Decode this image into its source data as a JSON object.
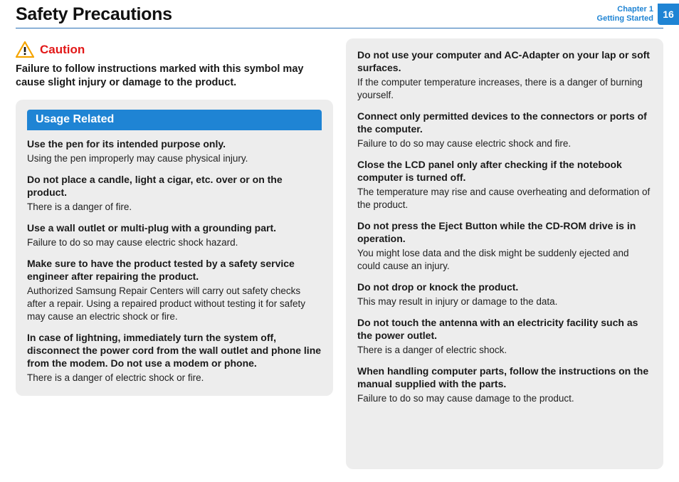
{
  "header": {
    "title": "Safety Precautions",
    "chapter_line1": "Chapter 1",
    "chapter_line2": "Getting Started",
    "page_number": "16"
  },
  "caution": {
    "label": "Caution",
    "description": "Failure to follow instructions marked with this symbol may cause slight injury or damage to the product."
  },
  "section": {
    "title": "Usage Related"
  },
  "left_items": [
    {
      "h": "Use the pen for its intended purpose only.",
      "b": "Using the pen improperly may cause physical injury."
    },
    {
      "h": "Do not place a candle, light a cigar, etc. over or on the product.",
      "b": "There is a danger of fire."
    },
    {
      "h": "Use a wall outlet or multi-plug with a grounding part.",
      "b": "Failure to do so may cause electric shock hazard."
    },
    {
      "h": "Make sure to have the product tested by a safety service engineer after repairing the product.",
      "b": "Authorized Samsung Repair Centers will carry out safety checks after a repair. Using a repaired product without testing it for safety may cause an electric shock or fire."
    },
    {
      "h": "In case of lightning, immediately turn the system off, disconnect the power cord from the wall outlet and phone line from the modem. Do not use a modem or phone.",
      "b": "There is a danger of electric shock or fire."
    }
  ],
  "right_items": [
    {
      "h": "Do not use your computer and AC-Adapter on your lap or soft surfaces.",
      "b": "If the computer temperature increases, there is a danger of burning yourself."
    },
    {
      "h": "Connect only permitted devices to the connectors or ports of the computer.",
      "b": "Failure to do so may cause electric shock and fire."
    },
    {
      "h": "Close the LCD panel only after checking if the notebook computer is turned off.",
      "b": "The temperature may rise and cause overheating and deformation of the product."
    },
    {
      "h": "Do not press the Eject Button while the CD-ROM drive is in operation.",
      "b": "You might lose data and the disk might be suddenly ejected and could cause an injury."
    },
    {
      "h": "Do not drop or knock the product.",
      "b": "This may result in injury or damage to the data."
    },
    {
      "h": "Do not touch the antenna with an electricity facility such as the power outlet.",
      "b": "There is a danger of electric shock."
    },
    {
      "h": "When handling computer parts, follow the instructions on the manual supplied with the parts.",
      "b": "Failure to do so may cause damage to the product."
    }
  ]
}
